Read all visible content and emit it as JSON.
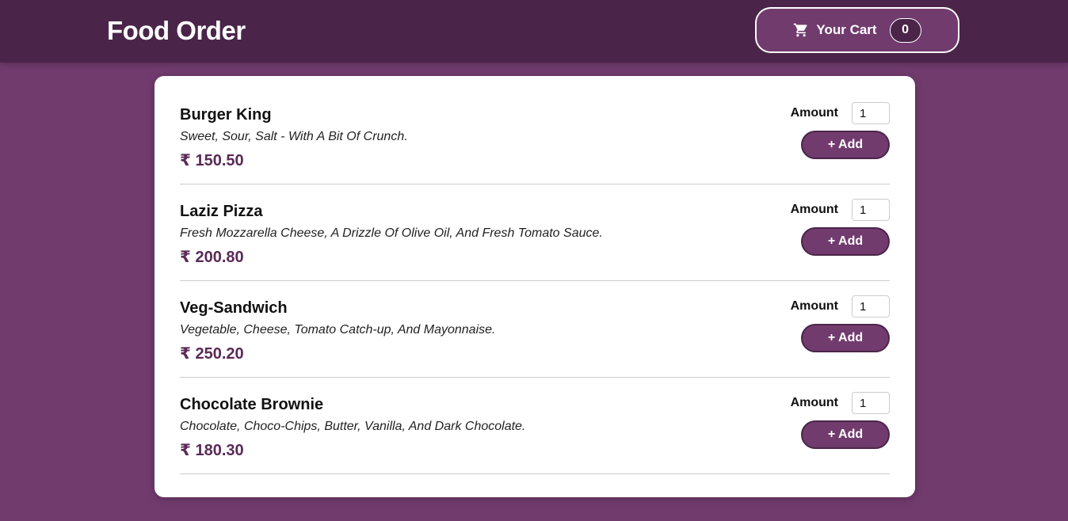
{
  "header": {
    "title": "Food Order",
    "cart": {
      "icon": "cart-icon",
      "label": "Your Cart",
      "count": "0"
    }
  },
  "meals": [
    {
      "name": "Burger King",
      "description": "Sweet, Sour, Salt - With A Bit Of Crunch.",
      "price": "₹ 150.50",
      "amount_label": "Amount",
      "amount_value": "1",
      "add_label": "+ Add"
    },
    {
      "name": "Laziz Pizza",
      "description": "Fresh Mozzarella Cheese, A Drizzle Of Olive Oil, And Fresh Tomato Sauce.",
      "price": "₹ 200.80",
      "amount_label": "Amount",
      "amount_value": "1",
      "add_label": "+ Add"
    },
    {
      "name": "Veg-Sandwich",
      "description": "Vegetable, Cheese, Tomato Catch-up, And Mayonnaise.",
      "price": "₹ 250.20",
      "amount_label": "Amount",
      "amount_value": "1",
      "add_label": "+ Add"
    },
    {
      "name": "Chocolate Brownie",
      "description": "Chocolate, Choco-Chips, Butter, Vanilla, And Dark Chocolate.",
      "price": "₹ 180.30",
      "amount_label": "Amount",
      "amount_value": "1",
      "add_label": "+ Add"
    }
  ],
  "colors": {
    "page_background": "#713b6e",
    "header_background": "#4a2549",
    "price_text": "#5a2a57",
    "button_background": "#713b6e",
    "button_border": "#4a2549"
  }
}
